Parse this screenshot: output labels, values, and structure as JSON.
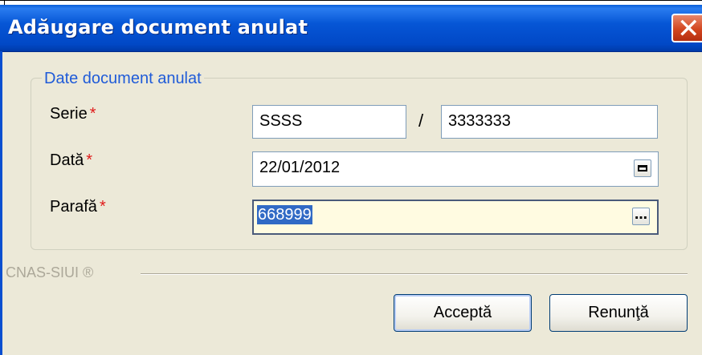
{
  "dialog": {
    "title": "Adăugare document anulat",
    "close_icon": "close-icon"
  },
  "group": {
    "legend": "Date document anulat"
  },
  "fields": {
    "serie_label": "Serie",
    "required_mark": "*",
    "serie_value": "SSSS",
    "separator": "/",
    "numar_value": "3333333",
    "data_label": "Dată",
    "data_value": "22/01/2012",
    "parafa_label": "Parafă",
    "parafa_value": "668999"
  },
  "footer": {
    "brand": "CNAS-SIUI ®"
  },
  "buttons": {
    "accept": "Acceptă",
    "cancel": "Renunţă"
  },
  "colors": {
    "titlebar": "#0656d6",
    "legend": "#1f5bd8",
    "required": "#e01a1a",
    "focused_field_bg": "#fffbe1"
  }
}
